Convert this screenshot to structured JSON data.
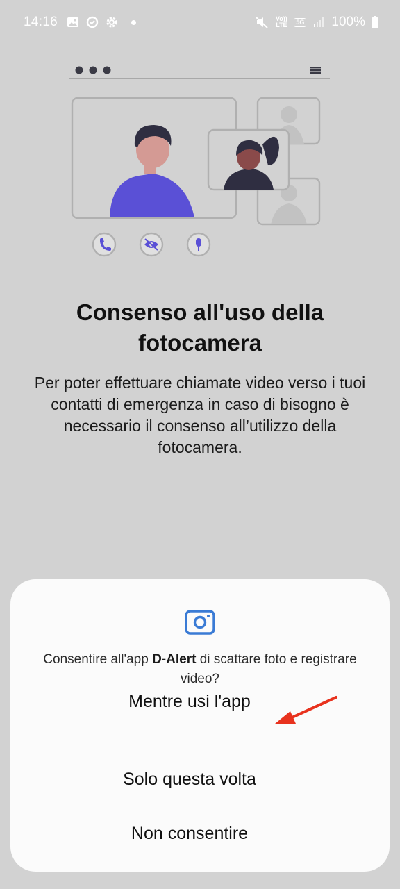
{
  "status_bar": {
    "time": "14:16",
    "left_icons": [
      "gallery-icon",
      "sync-icon",
      "settings-icon",
      "notification-dot"
    ],
    "right_icons": [
      "mute-icon",
      "volte-icon",
      "5g-icon",
      "signal-icon",
      "battery-icon"
    ],
    "volte_text": "Vo)) LTE",
    "network_text": "5G",
    "battery_text": "100%"
  },
  "content": {
    "title": "Consenso all'uso della fotocamera",
    "description": "Per poter effettuare chiamate video verso i tuoi contatti di emergenza in caso di bisogno è necessario il consenso all’utilizzo della fotocamera."
  },
  "illustration_icons": [
    "phone-icon",
    "eye-off-icon",
    "mic-icon"
  ],
  "permission_dialog": {
    "icon": "camera-icon",
    "message_prefix": "Consentire all'app ",
    "app_name": "D-Alert",
    "message_suffix": " di scattare foto e registrare video?",
    "options": [
      "Mentre usi l'app",
      "Solo questa volta",
      "Non consentire"
    ]
  },
  "colors": {
    "background": "#d2d2d2",
    "dialog": "#fbfbfb",
    "accent_purple": "#5a50d6",
    "camera_icon_blue": "#3a7bd5",
    "arrow_red": "#e8321e"
  }
}
